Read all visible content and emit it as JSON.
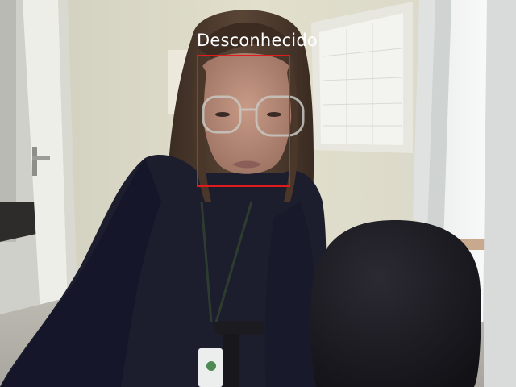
{
  "detection": {
    "label": "Desconhecido",
    "box_color": "#e11b1b",
    "label_color": "#ffffff"
  }
}
